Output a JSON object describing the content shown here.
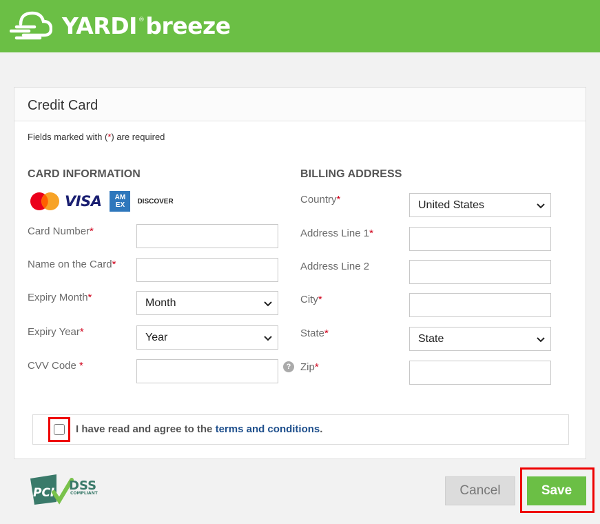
{
  "header": {
    "brand_main": "YARDI",
    "brand_reg": "®",
    "brand_sub": "breeze",
    "brand_color": "#6bbf45"
  },
  "card": {
    "title": "Credit Card",
    "required_note_prefix": "Fields marked with (",
    "required_note_star": "*",
    "required_note_suffix": ") are required"
  },
  "card_info": {
    "heading": "CARD INFORMATION",
    "card_logos": [
      "mastercard-icon",
      "visa-icon",
      "amex-icon",
      "discover-icon"
    ],
    "visa_text": "VISA",
    "amex_text": "AM EX",
    "discover_text": "DISCOVER",
    "card_number_label": "Card Number",
    "name_label": "Name on the Card",
    "expiry_month_label": "Expiry Month",
    "expiry_month_value": "Month",
    "expiry_year_label": "Expiry Year",
    "expiry_year_value": "Year",
    "cvv_label": "CVV Code ",
    "help_glyph": "?"
  },
  "billing": {
    "heading": "BILLING ADDRESS",
    "country_label": "Country",
    "country_value": "United States",
    "address1_label": "Address Line 1",
    "address2_label": "Address Line 2",
    "city_label": "City",
    "state_label": "State",
    "state_value": "State",
    "zip_label": "Zip"
  },
  "star": "*",
  "agreement": {
    "text_prefix": "I have read and agree to the ",
    "link_text": "terms and conditions",
    "text_suffix": "."
  },
  "footer": {
    "pci_text": "PCI",
    "dss_text": "DSS",
    "compliant_text": "COMPLIANT",
    "cancel_label": "Cancel",
    "save_label": "Save"
  }
}
